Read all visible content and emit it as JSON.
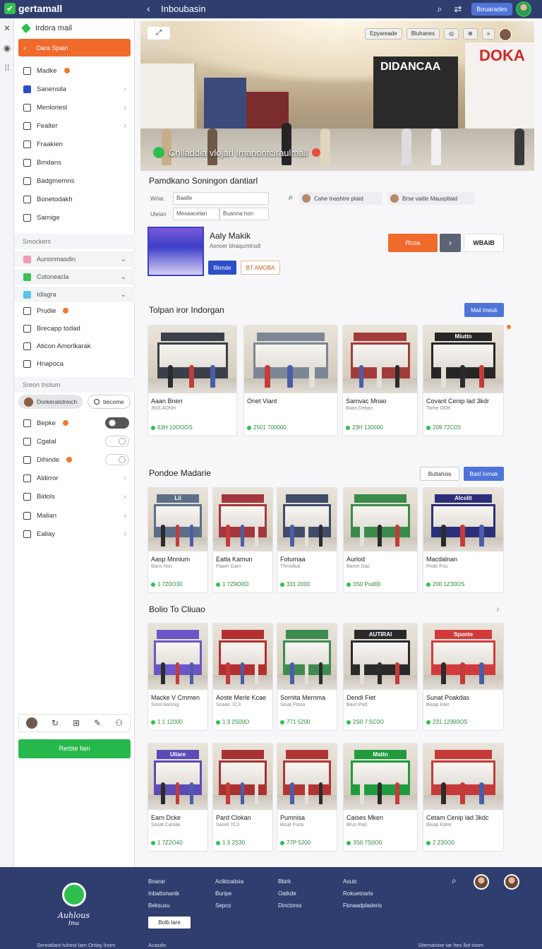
{
  "app": {
    "name": "gertamall",
    "page_title": "Inboubasin"
  },
  "topbar": {
    "primary_button": "Bouarades"
  },
  "sidebar": {
    "header": "Irdora mail",
    "primary_button": "Oara Spain",
    "items": [
      {
        "label": "Madke",
        "chevron": false,
        "badge": true
      },
      {
        "label": "Sanensila",
        "chevron": true,
        "badge": false
      },
      {
        "label": "Menloriesl",
        "chevron": true,
        "badge": false
      },
      {
        "label": "Fealter",
        "chevron": true,
        "badge": false
      },
      {
        "label": "Fraakien",
        "chevron": false,
        "badge": false
      },
      {
        "label": "Bmdans",
        "chevron": false,
        "badge": false
      },
      {
        "label": "Badgmemns",
        "chevron": false,
        "badge": false
      },
      {
        "label": "Bonetodakh",
        "chevron": false,
        "badge": false
      },
      {
        "label": "Sarnige",
        "chevron": false,
        "badge": false
      }
    ],
    "section_1": "Smockers",
    "groups": [
      {
        "label": "Aunonmasdin",
        "color": "#f29ab0"
      },
      {
        "label": "Cotoneacla",
        "color": "#3cbf5a"
      },
      {
        "label": "Idlagra",
        "color": "#5bc4e8"
      }
    ],
    "items_2": [
      {
        "label": "Prudie",
        "badge": true
      },
      {
        "label": "Brecapp todad",
        "badge": false
      },
      {
        "label": "Aticon Amorlkarak",
        "badge": false
      },
      {
        "label": "Hnapoca",
        "badge": false
      }
    ],
    "section_2": "Sreon tnolum",
    "chip_1": "Dorkeralstreich",
    "chip_2": "tiecome",
    "toggles": [
      {
        "label": "Bepke",
        "badge": true,
        "on": true
      },
      {
        "label": "Cgatal",
        "badge": false,
        "on": false
      },
      {
        "label": "Dihinde",
        "badge": true,
        "on": false
      }
    ],
    "items_3": [
      {
        "label": "Aldirror"
      },
      {
        "label": "Bidols"
      },
      {
        "label": "Malian"
      },
      {
        "label": "Ealiay"
      }
    ],
    "cta": "Rerbte fain"
  },
  "hero": {
    "caption": "Cnlladdia vlojarl Imanonfclraulmall",
    "chip_1": "Epyareade",
    "chip_2": "Bluhanes",
    "store_sign_1": "DIDANCAA",
    "store_sign_2": "DOKA"
  },
  "search": {
    "heading": "Pamdkano Soningon dantiarl",
    "label_1": "Wrlar.",
    "input_1": "Baalle",
    "label_2": "Uleian",
    "input_2": "Mesaacelan",
    "input_3": "Buanna hon",
    "filter_1": "Cahe tnashtre ptaid",
    "filter_2": "Brse vaitle Mauspltaid"
  },
  "featured": {
    "title": "Aaly Makik",
    "subtitle": "Asnoer bhaqumtrodl",
    "button_1": "Bkmde",
    "button_2": "BT AMOBA",
    "button_orange": "Rcoa",
    "brand": "WBAIB"
  },
  "sections": [
    {
      "title": "Tolpan iror Indorgan",
      "button": "Mail Inwuk",
      "cards": [
        {
          "name": "Aaan Bnen",
          "sub": "3NS 4ONH",
          "price": "63H 10OOOS",
          "sign": "",
          "tint": "#3b3f4a"
        },
        {
          "name": "Onet Viant",
          "sub": "",
          "price": "2501 700000",
          "sign": "",
          "tint": "#7c8795"
        },
        {
          "name": "Samvac Mnao",
          "sub": "Baas Dekpo",
          "price": "23H 130000",
          "sign": "",
          "tint": "#a33b3b"
        },
        {
          "name": "Covant Cenip lad 3kdr",
          "sub": "Tarhe ODK",
          "price": "209 72C0S",
          "sign": "Miuttn",
          "tint": "#262626"
        }
      ]
    },
    {
      "title": "Pondoe Madarie",
      "button_white": "Butlahsis",
      "button": "Banl Inmak",
      "cards": [
        {
          "name": "Aasp Mnnium",
          "sub": "Bans hon",
          "price": "1 7Z0O30",
          "sign": "Lii",
          "tint": "#5d6f88"
        },
        {
          "name": "Eatla Kamun",
          "sub": "Paaer Gam",
          "price": "1 7Z9O0O",
          "sign": "",
          "tint": "#a4373e"
        },
        {
          "name": "Fotumaa",
          "sub": "Thmidkal",
          "price": "331 2000",
          "sign": "",
          "tint": "#3f4c6a"
        },
        {
          "name": "Aurlod",
          "sub": "Banet Dao",
          "price": "3S0 Pod00",
          "sign": "",
          "tint": "#3a8a4a"
        },
        {
          "name": "Macdalnan",
          "sub": "Pnde Pou",
          "price": "200 1Z30OS",
          "sign": "Alcolit",
          "tint": "#2b2f7a"
        }
      ]
    },
    {
      "title": "Bolio To Cliuao",
      "cards": [
        {
          "name": "Macke V Cmmen",
          "sub": "Sinst Aamng",
          "price": "1 1 12000",
          "sign": "",
          "tint": "#6b55c9"
        },
        {
          "name": "Aoste Merle Kcae",
          "sub": "Snaan 7C3",
          "price": "1 3 2S00O",
          "sign": "",
          "tint": "#b43030"
        },
        {
          "name": "Sornita Mernma",
          "sub": "Sinat Ftosa",
          "price": "771 5200",
          "sign": "",
          "tint": "#3e8b51"
        },
        {
          "name": "Dendi Fiet",
          "sub": "Baur Pad",
          "price": "2S0 7.5C0O",
          "sign": "AUTIRAI",
          "tint": "#2a2a2a"
        },
        {
          "name": "Sunat Poakdas",
          "sub": "Bisap kiter",
          "price": "231 12300OS",
          "sign": "Sponte",
          "tint": "#d23b3b"
        }
      ]
    },
    {
      "cards": [
        {
          "name": "Earn Dcke",
          "sub": "Sasat Canlak",
          "price": "1 7Z2O40",
          "sign": "Uliare",
          "tint": "#5c4bb7"
        },
        {
          "name": "Pard Clokan",
          "sub": "Sanet 7C3",
          "price": "1 3 2S30",
          "sign": "",
          "tint": "#a83232"
        },
        {
          "name": "Pumnisa",
          "sub": "Bicat Fuca",
          "price": "77P 5200",
          "sign": "",
          "tint": "#b23535"
        },
        {
          "name": "Caises Mken",
          "sub": "Brus Pao",
          "price": "3S0 7S0O0",
          "sign": "Mattn",
          "tint": "#1f9b3e"
        },
        {
          "name": "Cetam Cenip lad 3kdc",
          "sub": "Bisap Kater",
          "price": "2 Z30O0",
          "sign": "",
          "tint": "#c63a3a"
        }
      ]
    }
  ],
  "footer": {
    "brand": "Auhlous",
    "brand_sub": "Ima",
    "col_1": [
      "Bnarar",
      "Inbattonantk",
      "Beksusu"
    ],
    "col_2": [
      "Aciktcaitsia",
      "Buripe",
      "Sepcs"
    ],
    "col_3": [
      "Bbirk",
      "Oatkde",
      "Dinctorss"
    ],
    "col_4": [
      "Aoulc",
      "Rokuetnaris",
      "Fbnaadpladeris"
    ],
    "button": "Bolb lare",
    "copy_1": "Sereatlant tuhest lam Ortiay lnom",
    "copy_2": "Acasdo",
    "copy_3": "Sitemanioe tar hes llot toom"
  }
}
